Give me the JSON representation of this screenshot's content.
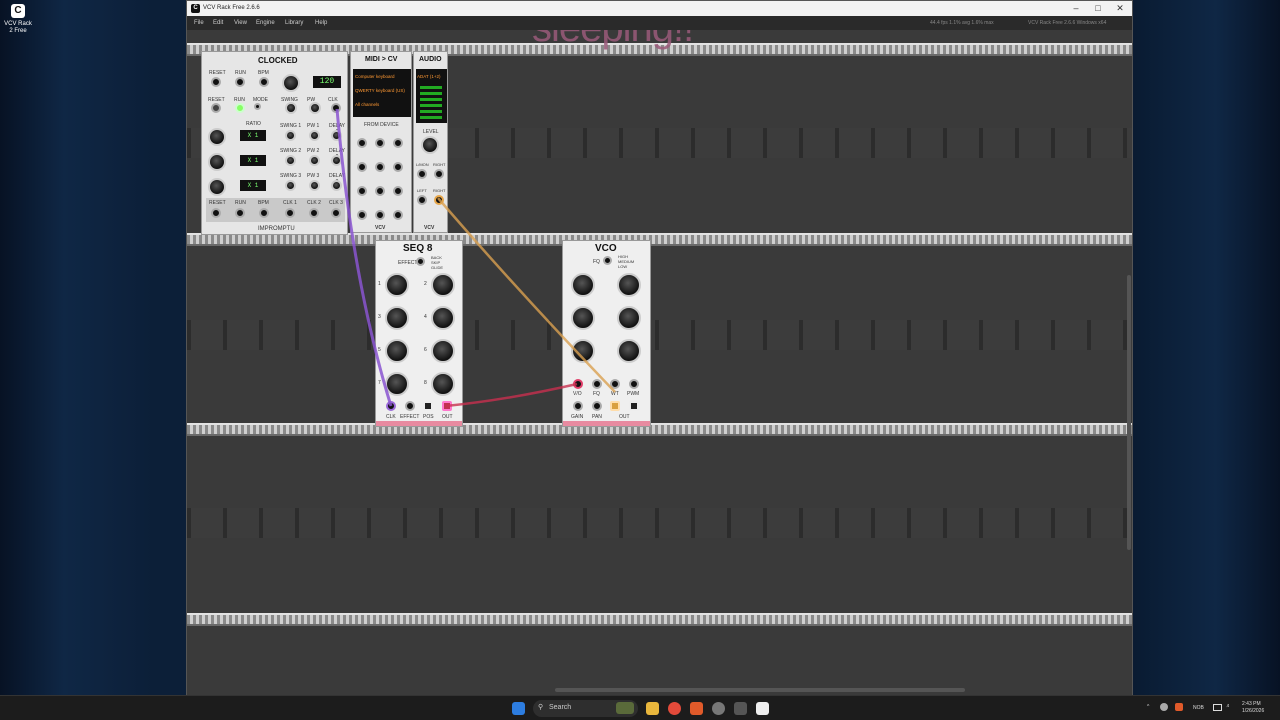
{
  "desktop": {
    "icon_label": "VCV Rack 2 Free",
    "icon_glyph": "C"
  },
  "window": {
    "title": "VCV Rack Free 2.6.6",
    "app_glyph": "C",
    "minimize": "–",
    "maximize": "□",
    "close": "✕"
  },
  "menu": {
    "file": "File",
    "edit": "Edit",
    "view": "View",
    "engine": "Engine",
    "library": "Library",
    "help": "Help"
  },
  "status": {
    "stats": "44.4 fps  1.1% avg  1.6% max",
    "version": "VCV Rack Free 2.6.6 Windows x64"
  },
  "overlay": {
    "text": "sleeping!!"
  },
  "clocked": {
    "title": "CLOCKED",
    "bpm_display": "120",
    "brand": "IMPROMPTU",
    "labels": [
      "RESET",
      "RUN",
      "BPM",
      "RESET",
      "RUN",
      "MODE",
      "SWING",
      "PW",
      "CLK",
      "RATIO",
      "SWING 1",
      "PW 1",
      "DELAY 1",
      "SWING 2",
      "PW 2",
      "DELAY 2",
      "SWING 3",
      "PW 3",
      "DELAY 3",
      "RESET",
      "RUN",
      "BPM",
      "CLK 1",
      "CLK 2",
      "CLK 3"
    ],
    "ratio_displays": [
      "X 1",
      "X 1",
      "X 1"
    ]
  },
  "midicv": {
    "title": "MIDI > CV",
    "driver": "Computer keyboard",
    "device": "QWERTY keyboard (US)",
    "channel": "All channels",
    "from_device": "FROM DEVICE",
    "brand": "VCV"
  },
  "audio": {
    "title": "AUDIO",
    "device": "ADAT (1+2)",
    "level": "LEVEL",
    "in": "L/MON",
    "right": "RIGHT",
    "left": "LEFT",
    "brand": "VCV"
  },
  "seq8": {
    "title": "SEQ 8",
    "labels": [
      "EFFECT",
      "BACK",
      "SKIP",
      "GLIDE",
      "CLK",
      "EFFECT",
      "POS",
      "OUT"
    ],
    "steps": [
      "1",
      "2",
      "3",
      "4",
      "5",
      "6",
      "7",
      "8"
    ]
  },
  "vco": {
    "title": "VCO",
    "labels": [
      "FQ",
      "HIGH",
      "MEDIUM",
      "LOW",
      "V/O",
      "FQ",
      "WT",
      "PWM",
      "GAIN",
      "PAN",
      "OUT"
    ]
  },
  "taskbar": {
    "search": "Search",
    "lang": "NOB",
    "time": "2:43 PM",
    "date": "1/26/2026"
  }
}
